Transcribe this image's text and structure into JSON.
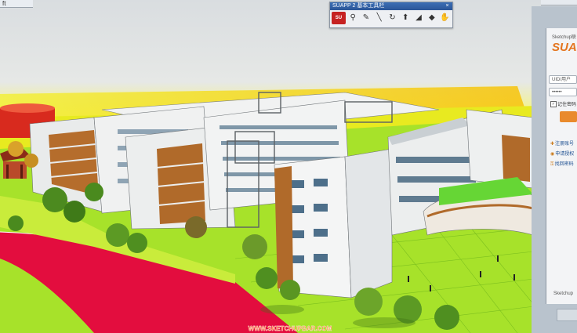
{
  "window": {
    "title_fragment": "ft"
  },
  "toolbar": {
    "title": "SUAPP 2 基本工具栏",
    "close_glyph": "×",
    "buttons": [
      {
        "name": "suapp-logo-button",
        "glyph": "SU"
      },
      {
        "name": "zoom-icon",
        "glyph": "⚲"
      },
      {
        "name": "measure-icon",
        "glyph": "✎"
      },
      {
        "name": "line-icon",
        "glyph": "╲"
      },
      {
        "name": "rotate-icon",
        "glyph": "↻"
      },
      {
        "name": "push-pull-icon",
        "glyph": "⬆"
      },
      {
        "name": "paint-icon",
        "glyph": "◢"
      },
      {
        "name": "shape-icon",
        "glyph": "◆"
      },
      {
        "name": "pan-icon",
        "glyph": "✋"
      },
      {
        "name": "lifebuoy-icon",
        "glyph": "◍"
      }
    ]
  },
  "panel": {
    "header": "Sketchup联",
    "logo": "SUAP",
    "uid_placeholder": "UID/用户",
    "password_mask": "••••••",
    "remember_label": "记住密码",
    "links": [
      {
        "icon": "✚",
        "label": "注册账号"
      },
      {
        "icon": "◉",
        "label": "申请授权"
      },
      {
        "icon": "⚿",
        "label": "找回密码"
      }
    ],
    "footer": "Sketchup"
  },
  "watermark": {
    "text": "WWW.SKETCHUPBAR.COM"
  },
  "colors": {
    "sky": "#dfe3e6",
    "horizon": "#f3f100",
    "ground": "#a7e22a",
    "track": "#e30d3e",
    "facade": "#eef0f0",
    "wood_panel": "#b06a2a",
    "accent": "#e4751f"
  }
}
